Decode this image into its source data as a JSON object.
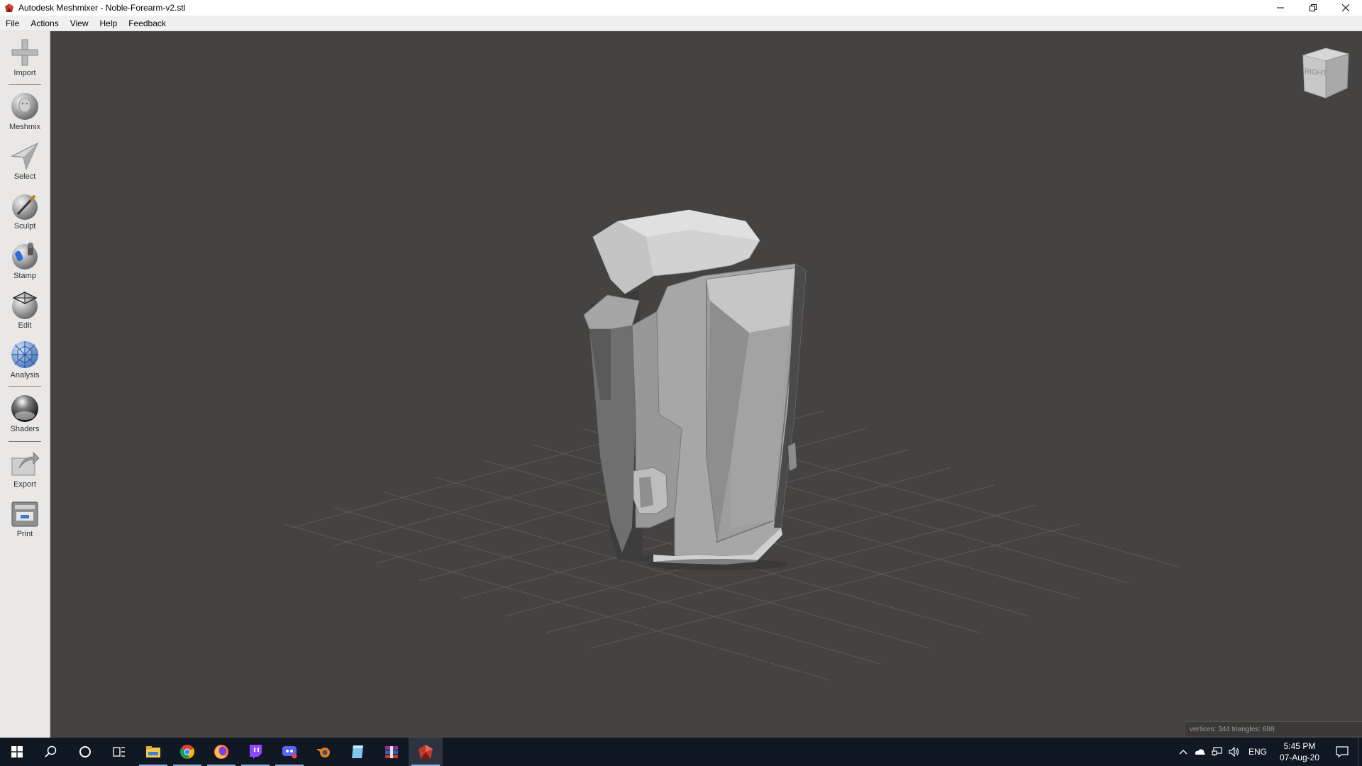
{
  "window": {
    "title": "Autodesk Meshmixer - Noble-Forearm-v2.stl",
    "controls": [
      "minimize-icon",
      "restore-icon",
      "close-icon"
    ]
  },
  "menu": {
    "file": "File",
    "actions": "Actions",
    "view": "View",
    "help": "Help",
    "feedback": "Feedback"
  },
  "toolbar": {
    "import": "Import",
    "meshmix": "Meshmix",
    "select": "Select",
    "sculpt": "Sculpt",
    "stamp": "Stamp",
    "edit": "Edit",
    "analysis": "Analysis",
    "shaders": "Shaders",
    "export": "Export",
    "print": "Print"
  },
  "viewport": {
    "viewcube_label": "RIGHT",
    "status": "vertices: 344 triangles: 688"
  },
  "taskbar": {
    "apps": [
      "windows-start-icon",
      "search-icon",
      "cortana-icon",
      "task-view-icon",
      "file-explorer-icon",
      "chrome-icon",
      "firefox-icon",
      "twitch-icon",
      "discord-icon",
      "blender-icon",
      "notepad-icon",
      "winrar-icon",
      "meshmixer-icon"
    ],
    "language": "ENG",
    "time": "5:45 PM",
    "date": "07-Aug-20"
  },
  "colors": {
    "viewport_bg": "#444341",
    "toolbar_bg": "#e9e8e7",
    "taskbar_bg": "#101823",
    "mesh_gray": "#a8a8a8"
  }
}
